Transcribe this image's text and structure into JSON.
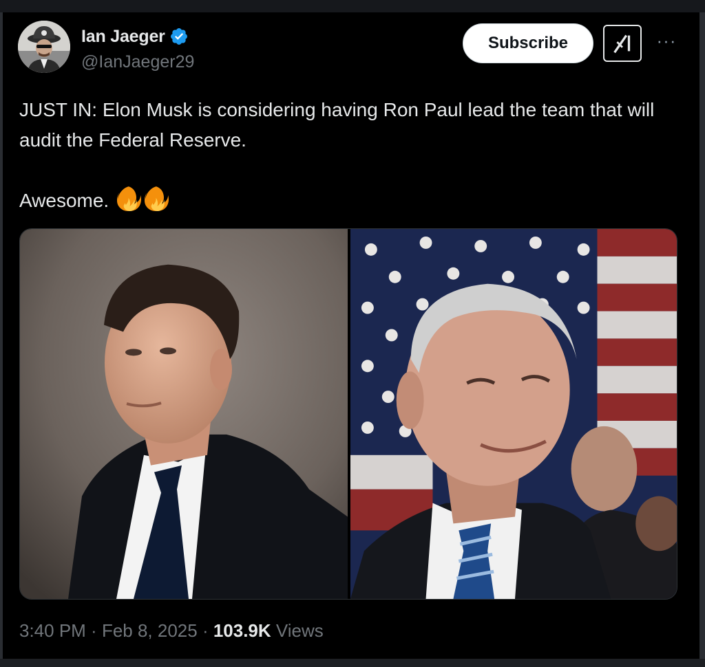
{
  "author": {
    "display_name": "Ian Jaeger",
    "handle": "@IanJaeger29",
    "verified": true,
    "avatar_icon": "avatar-icon"
  },
  "actions": {
    "subscribe_label": "Subscribe",
    "grok_icon": "grok-icon",
    "more_icon": "more-icon",
    "more_label": "···"
  },
  "tweet": {
    "line1": "JUST IN: Elon Musk is considering having Ron Paul lead the team that will audit the Federal Reserve.",
    "line2": "Awesome.",
    "emoji_icon": "fire-icon"
  },
  "media": {
    "images": [
      "elon-musk-photo",
      "ron-paul-photo"
    ]
  },
  "meta": {
    "time": "3:40 PM",
    "separator": " · ",
    "date": "Feb 8, 2025",
    "views_count": "103.9K",
    "views_label": " Views"
  },
  "colors": {
    "background": "#000000",
    "text": "#e7e9ea",
    "secondary_text": "#71767b",
    "verified_blue": "#1d9bf0"
  }
}
